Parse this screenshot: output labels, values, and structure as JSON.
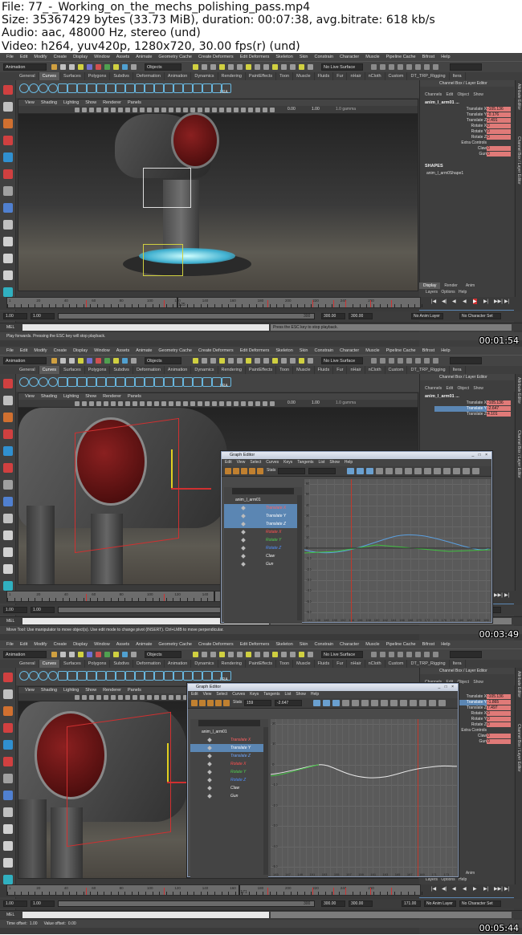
{
  "header": {
    "line1": "File: 77_-_Working_on_the_mechs_polishing_pass.mp4",
    "line2": "Size: 35367429 bytes (33.73 MiB), duration: 00:07:38, avg.bitrate: 618 kb/s",
    "line3": "Audio: aac, 48000 Hz, stereo (und)",
    "line4": "Video: h264, yuv420p, 1280x720, 30.00 fps(r) (und)"
  },
  "maya": {
    "menu": [
      "File",
      "Edit",
      "Modify",
      "Create",
      "Display",
      "Window",
      "Assets",
      "Animate",
      "Geometry Cache",
      "Create Deformers",
      "Edit Deformers",
      "Skeleton",
      "Skin",
      "Constrain",
      "Character",
      "Muscle",
      "Pipeline Cache",
      "Bifrost",
      "Help"
    ],
    "mode": "Animation",
    "objects_label": "Objects",
    "no_live_surface": "No Live Surface",
    "shelf_tabs": [
      "General",
      "Curves",
      "Surfaces",
      "Polygons",
      "Subdivs",
      "Deformation",
      "Animation",
      "Dynamics",
      "Rendering",
      "PaintEffects",
      "Toon",
      "Muscle",
      "Fluids",
      "Fur",
      "nHair",
      "nCloth",
      "Custom",
      "DT_TRP_Rigging",
      "Itera"
    ],
    "active_shelf": "Curves",
    "lra": "LRA",
    "viewport_menu": [
      "View",
      "Shading",
      "Lighting",
      "Show",
      "Renderer",
      "Panels"
    ],
    "viewport_val1": "0.00",
    "viewport_val2": "1.00",
    "viewport_gamma": "1.0 gamma",
    "channel_box_title": "Channel Box / Layer Editor",
    "channel_menu": "Channels Edit Object Show",
    "object_name": "anim_l_arm01 ...",
    "attributes": [
      "Translate X",
      "Translate Y",
      "Translate Z",
      "Rotate X",
      "Rotate Y",
      "Rotate Z",
      "Extra Controls",
      "Claw",
      "Gun"
    ],
    "frame1_values": [
      "-105.136",
      "-0.176",
      "2.491",
      "0",
      "0",
      "0",
      "",
      "0",
      "0"
    ],
    "frame2_values": [
      "-105.136",
      "-2.647",
      "4.101"
    ],
    "frame3_values": [
      "-105.136",
      "-1.865",
      "7.497",
      "0",
      "0",
      "0",
      "",
      "0",
      "0"
    ],
    "shapes_label": "SHAPES",
    "shape_name": "anim_l_arm0Shape1",
    "layer_tabs": [
      "Display",
      "Render",
      "Anim"
    ],
    "layer_menu": "Layers Options Help",
    "layers": [
      {
        "name": "set_layer",
        "color": "#3a3a3a"
      },
      {
        "name": "mech_layer",
        "color": "#1030c0"
      }
    ],
    "sidebar_labels": [
      "Attribute Editor",
      "Channel Box / Layer Editor"
    ],
    "timeline_labels": [
      "1",
      "10",
      "20",
      "30",
      "40",
      "50",
      "60",
      "70",
      "80",
      "90",
      "100",
      "110",
      "120",
      "130",
      "140",
      "150",
      "160",
      "170",
      "180",
      "190",
      "200",
      "210",
      "220",
      "230",
      "240",
      "250",
      "260",
      "270",
      "280",
      "290",
      "300"
    ],
    "frame1_current": "125",
    "frame3_current": "171",
    "range_start": "1.00",
    "range_inner_start": "1.00",
    "range_end": "300",
    "range_end2": "300.00",
    "range_end3": "300.00",
    "current_time_field_1": "",
    "current_time_field_3": "171.00",
    "no_anim_layer": "No Anim Layer",
    "no_character_set": "No Character Set",
    "mel": "MEL",
    "playback_msg": "Press the ESC key to stop playback.",
    "help1": "Play forwards. Pressing the ESC key will stop playback.",
    "help2": "Move Tool: Use manipulator to move object(s). Use edit mode to change pivot (INSERT). Ctrl+LMB to move perpendicular.",
    "help3_time": "Time offset:",
    "help3_time_val": "1.00",
    "help3_value": "Value offset:",
    "help3_value_val": "0.00"
  },
  "graph_editor": {
    "title": "Graph Editor",
    "menu": [
      "Edit",
      "View",
      "Select",
      "Curves",
      "Keys",
      "Tangents",
      "List",
      "Show",
      "Help"
    ],
    "stats_label": "Stats",
    "frame3_stat1": "159",
    "frame3_stat2": "-2.647",
    "node": "anim_l_arm01",
    "channels": [
      {
        "label": "Translate X",
        "color": "#ff6060"
      },
      {
        "label": "Translate Y",
        "color": "#80ff80"
      },
      {
        "label": "Translate Z",
        "color": "#70a8ff"
      },
      {
        "label": "Rotate X",
        "color": "#ff5050"
      },
      {
        "label": "Rotate Y",
        "color": "#50d050"
      },
      {
        "label": "Rotate Z",
        "color": "#5090ff"
      },
      {
        "label": "Claw",
        "color": "#eeeeee"
      },
      {
        "label": "Gun",
        "color": "#eeeeee"
      }
    ],
    "frame2_ylabels": [
      "60",
      "50",
      "40",
      "30",
      "20",
      "10",
      "0",
      "-10",
      "-20",
      "-30",
      "-40",
      "-50",
      "-60"
    ],
    "frame3_ylabels": [
      "20",
      "10",
      "0",
      "-10",
      "-20",
      "-30",
      "-40",
      "-50"
    ],
    "frame2_xlabels": [
      "144",
      "146",
      "148",
      "150",
      "152",
      "154",
      "156",
      "158",
      "160",
      "162",
      "164",
      "166",
      "168",
      "170",
      "172",
      "174",
      "176",
      "178",
      "180",
      "182",
      "184",
      "186"
    ],
    "frame3_xlabels": [
      "145",
      "146",
      "147",
      "148",
      "149",
      "150",
      "151",
      "152",
      "153",
      "154",
      "155",
      "156",
      "157",
      "158",
      "159",
      "160",
      "161",
      "162",
      "163",
      "164",
      "165",
      "166",
      "167",
      "168",
      "169",
      "170",
      "171",
      "172",
      "173",
      "174"
    ]
  },
  "timestamps": [
    "00:01:54",
    "00:03:49",
    "00:05:44"
  ]
}
